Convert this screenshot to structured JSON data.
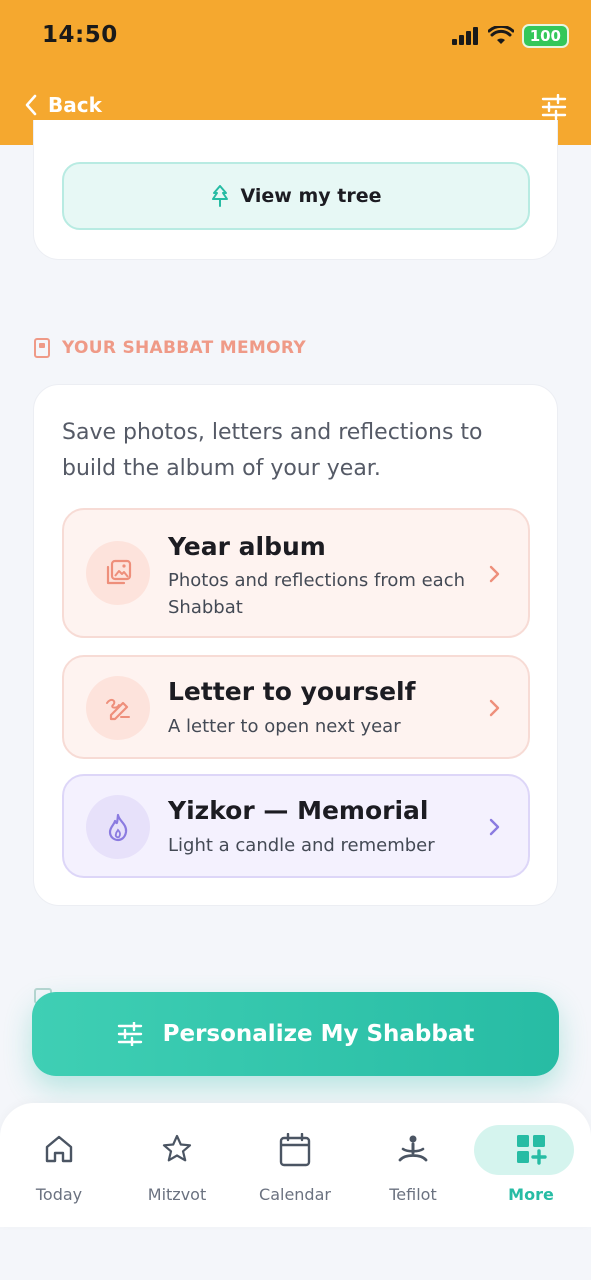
{
  "status_bar": {
    "time": "14:50",
    "battery": "100"
  },
  "header": {
    "back_label": "Back"
  },
  "tree_card": {
    "button_label": "View my tree"
  },
  "memory_section": {
    "label": "YOUR SHABBAT MEMORY",
    "description": "Save photos, letters and reflections to build the album of your year.",
    "items": [
      {
        "title": "Year album",
        "subtitle": "Photos and reflections from each Shabbat"
      },
      {
        "title": "Letter to yourself",
        "subtitle": "A letter to open next year"
      },
      {
        "title": "Yizkor — Memorial",
        "subtitle": "Light a candle and remember"
      }
    ]
  },
  "cta": {
    "label": "Personalize My Shabbat"
  },
  "tabbar": {
    "tabs": [
      {
        "label": "Today",
        "icon": "home-icon"
      },
      {
        "label": "Mitzvot",
        "icon": "star-icon"
      },
      {
        "label": "Calendar",
        "icon": "calendar-icon"
      },
      {
        "label": "Tefilot",
        "icon": "prayer-icon"
      },
      {
        "label": "More",
        "icon": "grid-plus-icon",
        "active": true
      }
    ]
  },
  "colors": {
    "header": "#f5a82f",
    "accent": "#27bca4",
    "section_label": "#ef9a87"
  }
}
